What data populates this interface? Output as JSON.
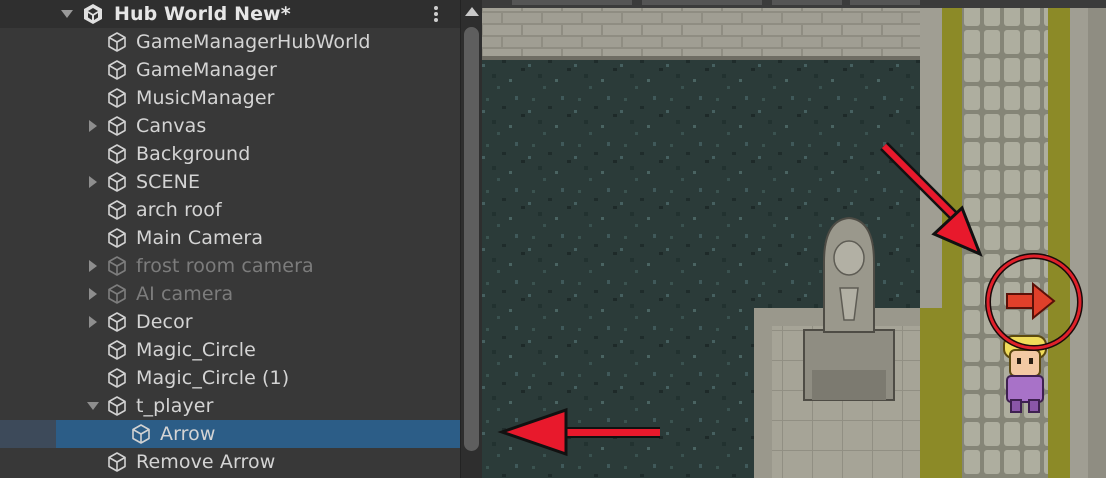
{
  "hierarchy": {
    "scene_title": "Hub World New*",
    "items": [
      {
        "label": "GameManagerHubWorld",
        "level": 0,
        "expander": "none",
        "dimmed": false
      },
      {
        "label": "GameManager",
        "level": 0,
        "expander": "none",
        "dimmed": false
      },
      {
        "label": "MusicManager",
        "level": 0,
        "expander": "none",
        "dimmed": false
      },
      {
        "label": "Canvas",
        "level": 0,
        "expander": "collapsed",
        "dimmed": false
      },
      {
        "label": "Background",
        "level": 0,
        "expander": "none",
        "dimmed": false
      },
      {
        "label": "SCENE",
        "level": 0,
        "expander": "collapsed",
        "dimmed": false
      },
      {
        "label": "arch roof",
        "level": 0,
        "expander": "none",
        "dimmed": false
      },
      {
        "label": "Main Camera",
        "level": 0,
        "expander": "none",
        "dimmed": false
      },
      {
        "label": "frost room camera",
        "level": 0,
        "expander": "collapsed",
        "dimmed": true
      },
      {
        "label": "AI camera",
        "level": 0,
        "expander": "collapsed",
        "dimmed": true
      },
      {
        "label": "Decor",
        "level": 0,
        "expander": "collapsed",
        "dimmed": false
      },
      {
        "label": "Magic_Circle",
        "level": 0,
        "expander": "none",
        "dimmed": false
      },
      {
        "label": "Magic_Circle (1)",
        "level": 0,
        "expander": "none",
        "dimmed": false
      },
      {
        "label": "t_player",
        "level": 0,
        "expander": "expanded",
        "dimmed": false
      },
      {
        "label": "Arrow",
        "level": 1,
        "expander": "none",
        "dimmed": false,
        "selected": true
      },
      {
        "label": "Remove Arrow",
        "level": 0,
        "expander": "none",
        "dimmed": false
      }
    ]
  },
  "icons": {
    "scene": "unity-logo-icon",
    "gameobject": "cube-icon",
    "menu": "kebab-menu-icon",
    "scroll_up": "scroll-up-arrow-icon"
  },
  "colors": {
    "panel_bg": "#383838",
    "selection": "#2c5d87",
    "annotation_arrow": "#e8192c",
    "path_moss": "#8a8a26",
    "stone": "#9a9a8c"
  }
}
